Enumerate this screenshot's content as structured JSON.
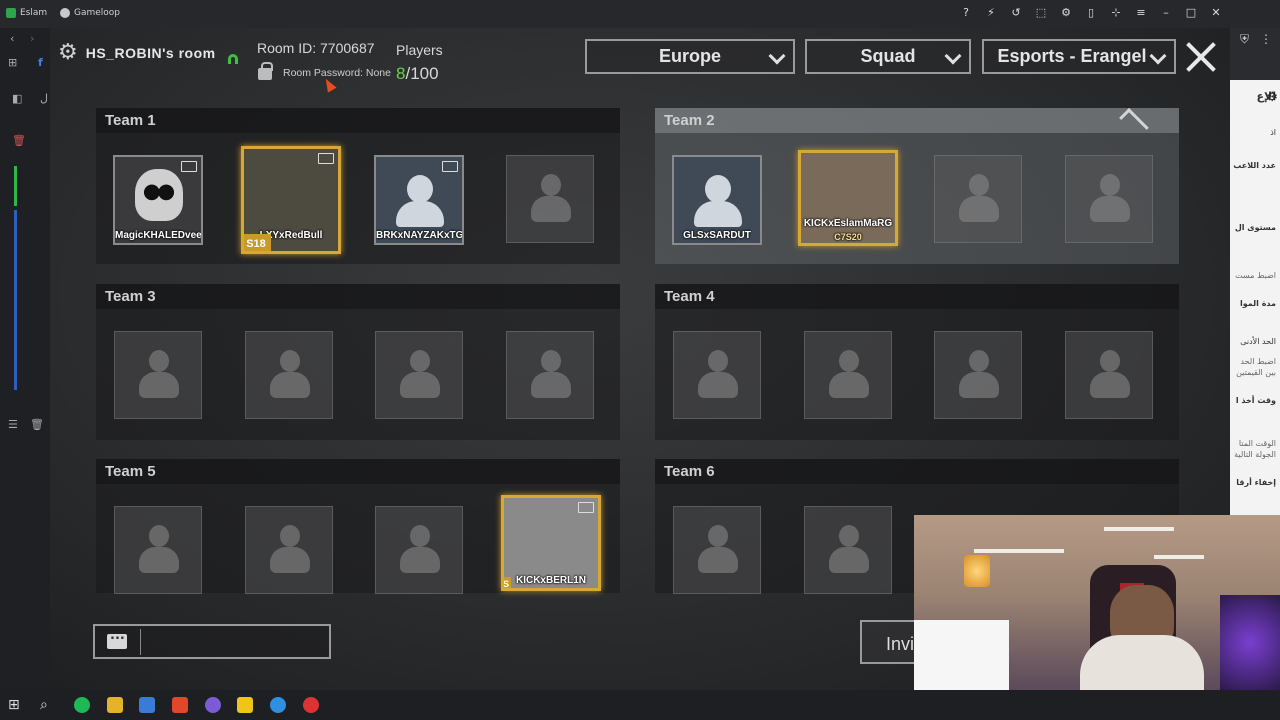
{
  "browser": {
    "tab1_label": "Eslam",
    "tab2_label": "Gameloop",
    "left_f_icon": "f",
    "left_label": "ل"
  },
  "room": {
    "host_name": "HS_ROBIN's room",
    "room_id": "Room ID: 7700687",
    "password_text": "Room Password: None",
    "players_label": "Players",
    "players_current": "8",
    "players_max": "/100"
  },
  "filters": {
    "region": "Europe",
    "mode": "Squad",
    "map": "Esports - Erangel"
  },
  "teams": [
    {
      "name": "Team 1",
      "players": [
        "MagicKHALEDvee",
        "LXYxRedBull",
        "BRKxNAYZAKxTGA"
      ]
    },
    {
      "name": "Team 2",
      "players": [
        "GLSxSARDUT",
        "KICKxEslamMaRG"
      ]
    },
    {
      "name": "Team 3",
      "players": []
    },
    {
      "name": "Team 4",
      "players": []
    },
    {
      "name": "Team 5",
      "players": [
        "KICKxBERL1N"
      ]
    },
    {
      "name": "Team 6",
      "players": []
    }
  ],
  "badges": {
    "redbull_badge": "S18",
    "eslam_badge": "C7S20",
    "berlin_badge": "S"
  },
  "invite_label": "Invi",
  "side_panel": {
    "header": "الإع",
    "items": [
      "عدد اللاعب",
      "مستوى ال",
      "اضبط مست",
      "مدة الموا",
      "الحد الأدنى",
      "اضبط الحد",
      "بين القيمتين",
      "وقت أخذ ا",
      "الوقت المتا",
      "الجولة التالية",
      "إخفاء أرقا"
    ],
    "short_item": "اذ"
  },
  "colors": {
    "player_count_green": "#69d146",
    "gold_frame": "#d7a837",
    "wifi_green": "#3fbf3f"
  }
}
